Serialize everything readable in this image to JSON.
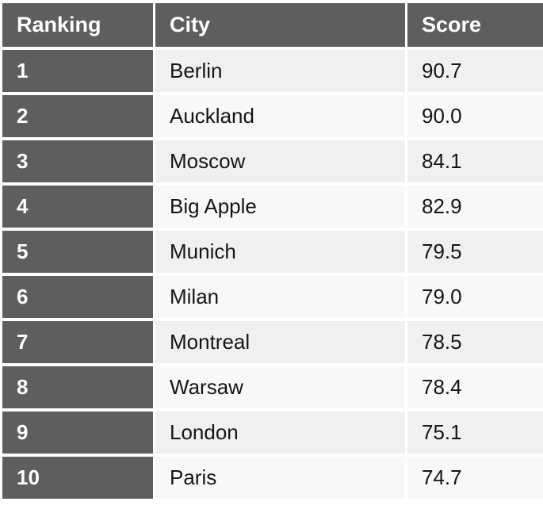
{
  "table": {
    "columns": [
      {
        "key": "ranking",
        "label": "Ranking"
      },
      {
        "key": "city",
        "label": "City"
      },
      {
        "key": "score",
        "label": "Score"
      }
    ],
    "rows": [
      {
        "ranking": "1",
        "city": "Berlin",
        "score": "90.7"
      },
      {
        "ranking": "2",
        "city": "Auckland",
        "score": "90.0"
      },
      {
        "ranking": "3",
        "city": "Moscow",
        "score": "84.1"
      },
      {
        "ranking": "4",
        "city": "Big Apple",
        "score": "82.9"
      },
      {
        "ranking": "5",
        "city": "Munich",
        "score": "79.5"
      },
      {
        "ranking": "6",
        "city": "Milan",
        "score": "79.0"
      },
      {
        "ranking": "7",
        "city": "Montreal",
        "score": "78.5"
      },
      {
        "ranking": "8",
        "city": "Warsaw",
        "score": "78.4"
      },
      {
        "ranking": "9",
        "city": "London",
        "score": "75.1"
      },
      {
        "ranking": "10",
        "city": "Paris",
        "score": "74.7"
      }
    ]
  },
  "colors": {
    "header_background": "#5e5e5e",
    "header_text": "#ffffff",
    "rank_background": "#5e5e5e",
    "rank_text": "#ffffff",
    "row_odd_background": "#f0f0f0",
    "row_even_background": "#f8f8f8",
    "body_text": "#151515",
    "page_background": "#ffffff"
  }
}
